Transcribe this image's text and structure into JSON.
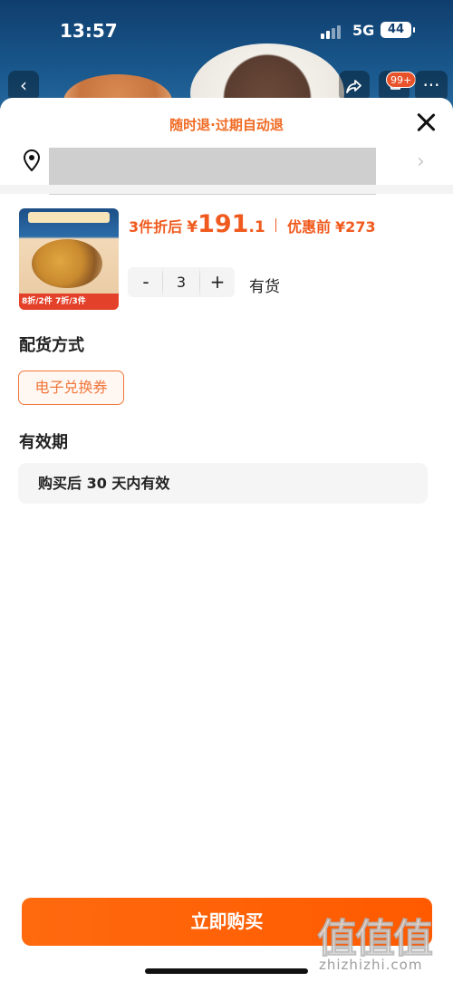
{
  "status_bar": {
    "time": "13:57",
    "network": "5G",
    "battery": "44"
  },
  "background_page": {
    "cart_badge": "99+",
    "icons": [
      "chevron-left-icon",
      "share-icon",
      "cart-icon",
      "more-icon"
    ]
  },
  "sheet": {
    "refund_text": "随时退·过期自动退",
    "close_icon": "close-icon"
  },
  "address": {
    "icon": "location-pin-icon",
    "chevron": "›"
  },
  "product": {
    "price_prefix": "3件折后",
    "currency": "¥",
    "price_integer": "191",
    "price_decimal": ".1",
    "original_label": "优惠前",
    "original_price": "¥273",
    "image_banner": "8折/2件 7折/3件",
    "quantity": "3",
    "minus": "-",
    "plus": "+",
    "stock_status": "有货"
  },
  "delivery": {
    "title": "配货方式",
    "option": "电子兑换券"
  },
  "validity": {
    "title": "有效期",
    "text": "购买后 30 天内有效"
  },
  "buy_button": {
    "label": "立即购买",
    "color": "#ff5a00"
  },
  "watermark": {
    "logo": "值值值",
    "text": "zhizhizhi.com"
  },
  "colors": {
    "accent": "#f06a23",
    "price": "#f05a1e"
  }
}
